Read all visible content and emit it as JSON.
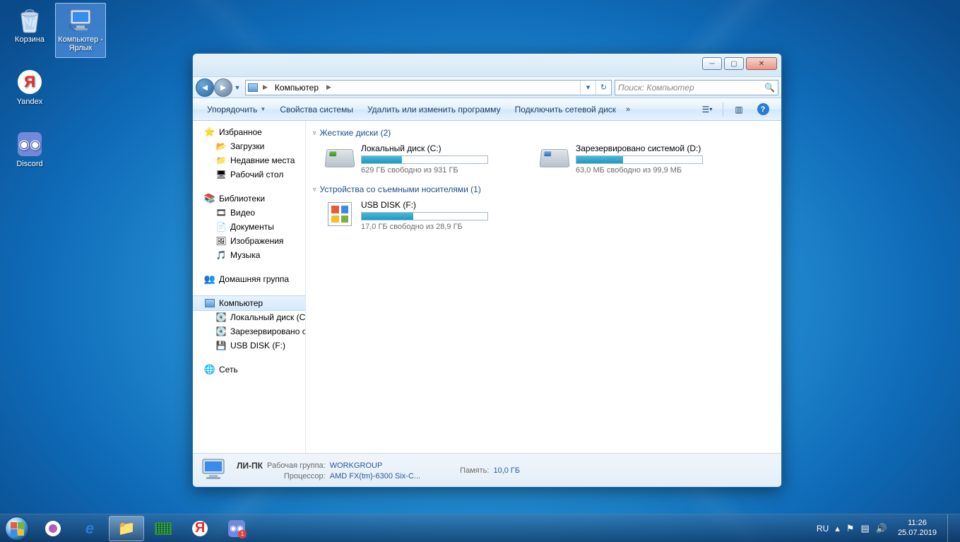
{
  "desktop_icons": {
    "recycle": "Корзина",
    "computer": "Компьютер - Ярлык",
    "yandex": "Yandex",
    "discord": "Discord"
  },
  "window": {
    "breadcrumb": "Компьютер",
    "search_placeholder": "Поиск: Компьютер",
    "toolbar": {
      "organize": "Упорядочить",
      "sys_props": "Свойства системы",
      "uninstall": "Удалить или изменить программу",
      "map_drive": "Подключить сетевой диск"
    },
    "nav": {
      "favorites": "Избранное",
      "downloads": "Загрузки",
      "recent": "Недавние места",
      "desktop": "Рабочий стол",
      "libraries": "Библиотеки",
      "video": "Видео",
      "documents": "Документы",
      "images": "Изображения",
      "music": "Музыка",
      "homegroup": "Домашняя группа",
      "computer": "Компьютер",
      "local_c": "Локальный диск (C:)",
      "reserved_d": "Зарезервировано системой (D:)",
      "usb_f": "USB DISK (F:)",
      "network": "Сеть"
    },
    "cat_hdd": "Жесткие диски (2)",
    "cat_rem": "Устройства со съемными носителями (1)",
    "drives": {
      "c": {
        "name": "Локальный диск (C:)",
        "sub": "629 ГБ свободно из 931 ГБ",
        "pct": 32
      },
      "d": {
        "name": "Зарезервировано системой (D:)",
        "sub": "63,0 МБ свободно из 99,9 МБ",
        "pct": 37
      },
      "f": {
        "name": "USB DISK (F:)",
        "sub": "17,0 ГБ свободно из 28,9 ГБ",
        "pct": 41
      }
    },
    "status": {
      "name": "ЛИ-ПК",
      "wg_label": "Рабочая группа:",
      "workgroup": "WORKGROUP",
      "cpu_label": "Процессор:",
      "cpu": "AMD FX(tm)-6300 Six-C...",
      "mem_label": "Память:",
      "memory": "10,0 ГБ"
    }
  },
  "taskbar": {
    "lang": "RU",
    "time": "11:26",
    "date": "25.07.2019"
  }
}
